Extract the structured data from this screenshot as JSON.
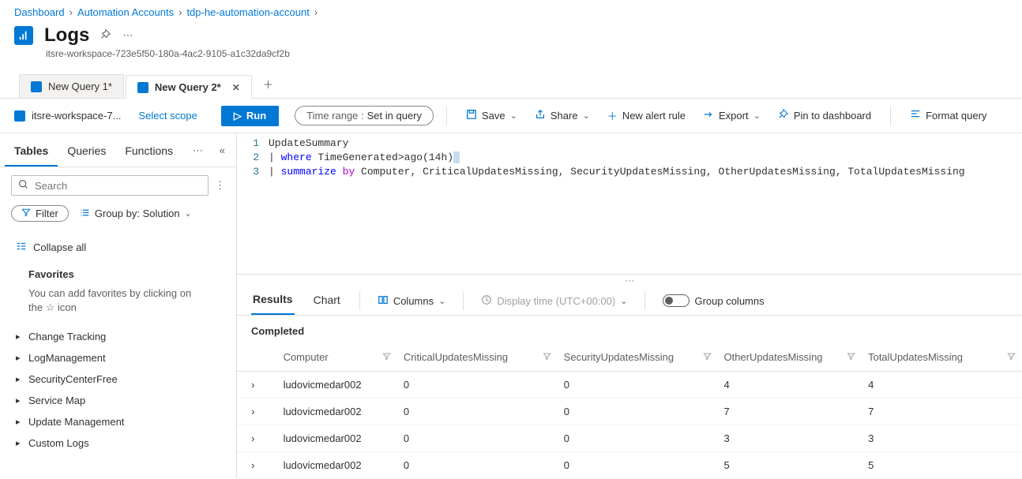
{
  "breadcrumb": [
    {
      "label": "Dashboard"
    },
    {
      "label": "Automation Accounts"
    },
    {
      "label": "tdp-he-automation-account"
    }
  ],
  "page": {
    "title": "Logs",
    "subtitle": "itsre-workspace-723e5f50-180a-4ac2-9105-a1c32da9cf2b"
  },
  "query_tabs": [
    {
      "label": "New Query 1*",
      "active": false
    },
    {
      "label": "New Query 2*",
      "active": true
    }
  ],
  "toolbar": {
    "workspace": "itsre-workspace-7...",
    "scope_link": "Select scope",
    "run": "Run",
    "time_label": "Time range :",
    "time_value": "Set in query",
    "save": "Save",
    "share": "Share",
    "alert": "New alert rule",
    "export": "Export",
    "pin": "Pin to dashboard",
    "format": "Format query"
  },
  "sidebar": {
    "tabs": [
      "Tables",
      "Queries",
      "Functions"
    ],
    "search_placeholder": "Search",
    "filter": "Filter",
    "group_by": "Group by: Solution",
    "collapse": "Collapse all",
    "favorites_title": "Favorites",
    "favorites_body_a": "You can add favorites by clicking on",
    "favorites_body_b": "the ☆ icon",
    "tree": [
      "Change Tracking",
      "LogManagement",
      "SecurityCenterFree",
      "Service Map",
      "Update Management",
      "Custom Logs"
    ]
  },
  "editor": {
    "lines": {
      "l1_plain": "UpdateSummary",
      "l2_kw": "where",
      "l2_rest": " TimeGenerated>ago(14h)",
      "l3_kw1": "summarize",
      "l3_kw2": "by",
      "l3_rest": " Computer, CriticalUpdatesMissing, SecurityUpdatesMissing, OtherUpdatesMissing, TotalUpdatesMissing"
    }
  },
  "results": {
    "tabs": [
      "Results",
      "Chart"
    ],
    "columns_btn": "Columns",
    "display_time": "Display time (UTC+00:00)",
    "group_cols": "Group columns",
    "status": "Completed",
    "headers": [
      "Computer",
      "CriticalUpdatesMissing",
      "SecurityUpdatesMissing",
      "OtherUpdatesMissing",
      "TotalUpdatesMissing"
    ],
    "rows": [
      {
        "computer": "ludovicmedar002",
        "crit": "0",
        "sec": "0",
        "other": "4",
        "total": "4"
      },
      {
        "computer": "ludovicmedar002",
        "crit": "0",
        "sec": "0",
        "other": "7",
        "total": "7"
      },
      {
        "computer": "ludovicmedar002",
        "crit": "0",
        "sec": "0",
        "other": "3",
        "total": "3"
      },
      {
        "computer": "ludovicmedar002",
        "crit": "0",
        "sec": "0",
        "other": "5",
        "total": "5"
      }
    ]
  }
}
